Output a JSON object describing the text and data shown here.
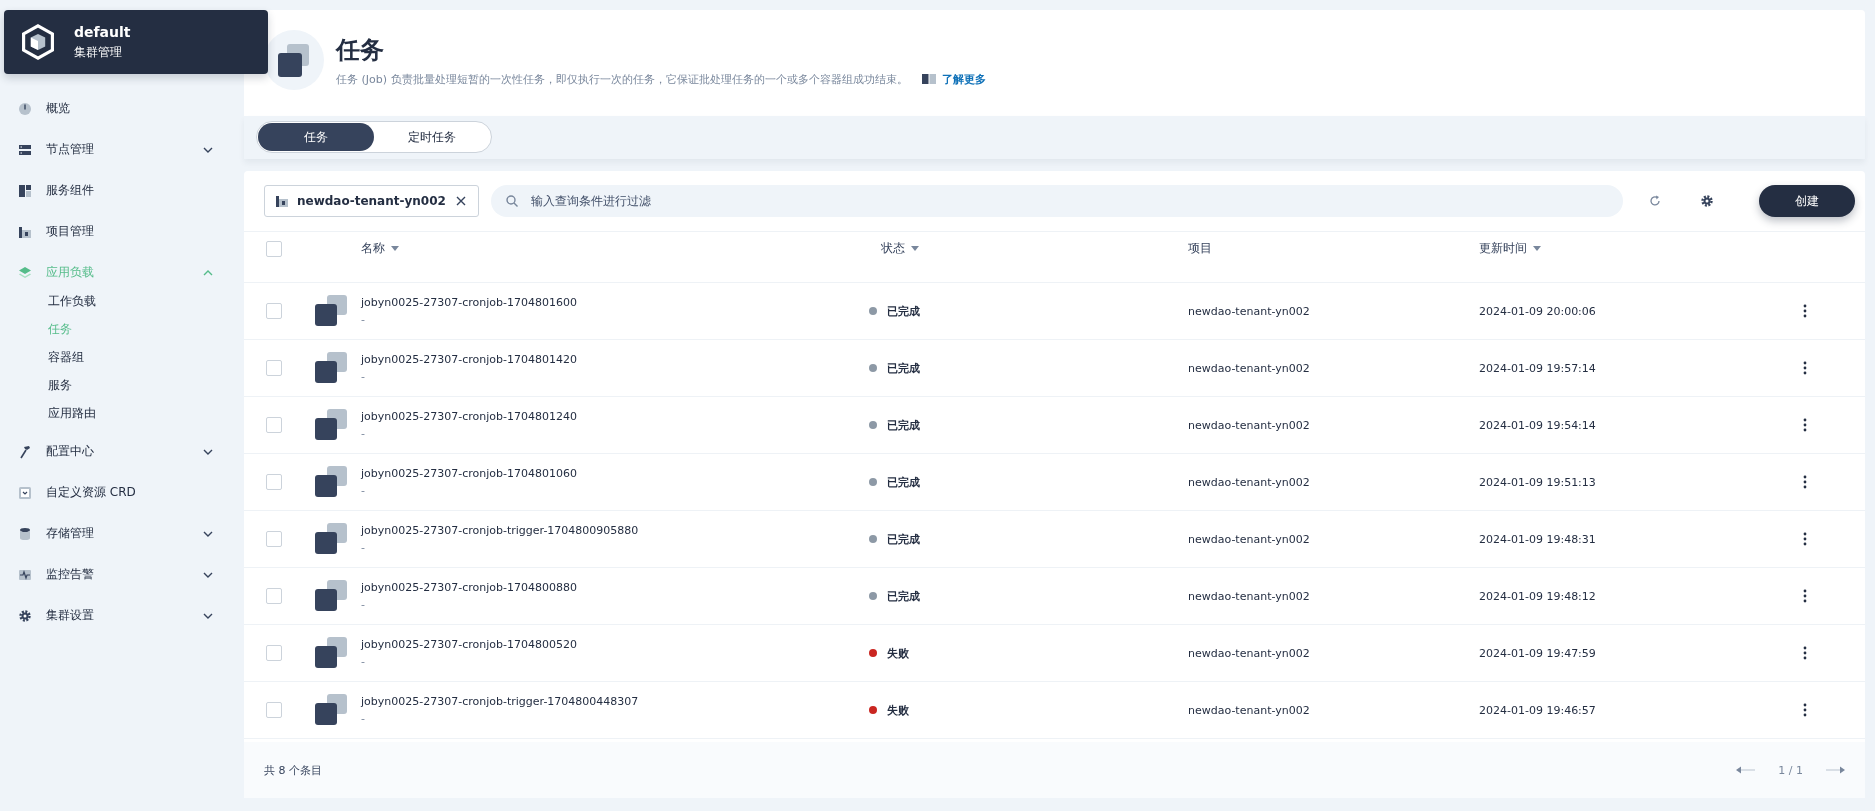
{
  "cluster": {
    "title": "default",
    "subtitle": "集群管理"
  },
  "nav": [
    {
      "label": "概览",
      "selected": false
    },
    {
      "label": "节点管理",
      "selected": false,
      "expanded": false
    },
    {
      "label": "服务组件",
      "selected": false
    },
    {
      "label": "项目管理",
      "selected": false
    },
    {
      "label": "应用负载",
      "selected": true,
      "expanded": true,
      "children": [
        {
          "label": "工作负载",
          "selected": false
        },
        {
          "label": "任务",
          "selected": true
        },
        {
          "label": "容器组",
          "selected": false
        },
        {
          "label": "服务",
          "selected": false
        },
        {
          "label": "应用路由",
          "selected": false
        }
      ]
    },
    {
      "label": "配置中心",
      "selected": false,
      "expanded": false
    },
    {
      "label": "自定义资源 CRD",
      "selected": false
    },
    {
      "label": "存储管理",
      "selected": false,
      "expanded": false
    },
    {
      "label": "监控告警",
      "selected": false,
      "expanded": false
    },
    {
      "label": "集群设置",
      "selected": false,
      "expanded": false
    }
  ],
  "page": {
    "title": "任务",
    "description": "任务 (Job) 负责批量处理短暂的一次性任务，即仅执行一次的任务，它保证批处理任务的一个或多个容器组成功结束。",
    "link": "了解更多"
  },
  "tabs": [
    {
      "label": "任务",
      "selected": true
    },
    {
      "label": "定时任务",
      "selected": false
    }
  ],
  "toolbar": {
    "project_filter": "newdao-tenant-yn002",
    "search": {
      "placeholder": "输入查询条件进行过滤"
    },
    "create_button": "创建"
  },
  "table": {
    "select_all_checked": false,
    "columns": [
      {
        "label": "名称",
        "sortable": true
      },
      {
        "label": "状态",
        "sortable": true
      },
      {
        "label": "项目",
        "sortable": false
      },
      {
        "label": "更新时间",
        "sortable": true
      }
    ],
    "rows": [
      {
        "name": "jobyn0025-27307-cronjob-1704801600",
        "description": "-",
        "status": "已完成",
        "color": "#8d99a6",
        "project": "newdao-tenant-yn002",
        "updated": "2024-01-09 20:00:06",
        "checked": false
      },
      {
        "name": "jobyn0025-27307-cronjob-1704801420",
        "description": "-",
        "status": "已完成",
        "color": "#8d99a6",
        "project": "newdao-tenant-yn002",
        "updated": "2024-01-09 19:57:14",
        "checked": false
      },
      {
        "name": "jobyn0025-27307-cronjob-1704801240",
        "description": "-",
        "status": "已完成",
        "color": "#8d99a6",
        "project": "newdao-tenant-yn002",
        "updated": "2024-01-09 19:54:14",
        "checked": false
      },
      {
        "name": "jobyn0025-27307-cronjob-1704801060",
        "description": "-",
        "status": "已完成",
        "color": "#8d99a6",
        "project": "newdao-tenant-yn002",
        "updated": "2024-01-09 19:51:13",
        "checked": false
      },
      {
        "name": "jobyn0025-27307-cronjob-trigger-1704800905880",
        "description": "-",
        "status": "已完成",
        "color": "#8d99a6",
        "project": "newdao-tenant-yn002",
        "updated": "2024-01-09 19:48:31",
        "checked": false
      },
      {
        "name": "jobyn0025-27307-cronjob-1704800880",
        "description": "-",
        "status": "已完成",
        "color": "#8d99a6",
        "project": "newdao-tenant-yn002",
        "updated": "2024-01-09 19:48:12",
        "checked": false
      },
      {
        "name": "jobyn0025-27307-cronjob-1704800520",
        "description": "-",
        "status": "失败",
        "color": "#ca2621",
        "project": "newdao-tenant-yn002",
        "updated": "2024-01-09 19:47:59",
        "checked": false
      },
      {
        "name": "jobyn0025-27307-cronjob-trigger-1704800448307",
        "description": "-",
        "status": "失败",
        "color": "#ca2621",
        "project": "newdao-tenant-yn002",
        "updated": "2024-01-09 19:46:57",
        "checked": false
      }
    ]
  },
  "footer": {
    "total": "共 8 个条目",
    "page": "1 / 1"
  }
}
